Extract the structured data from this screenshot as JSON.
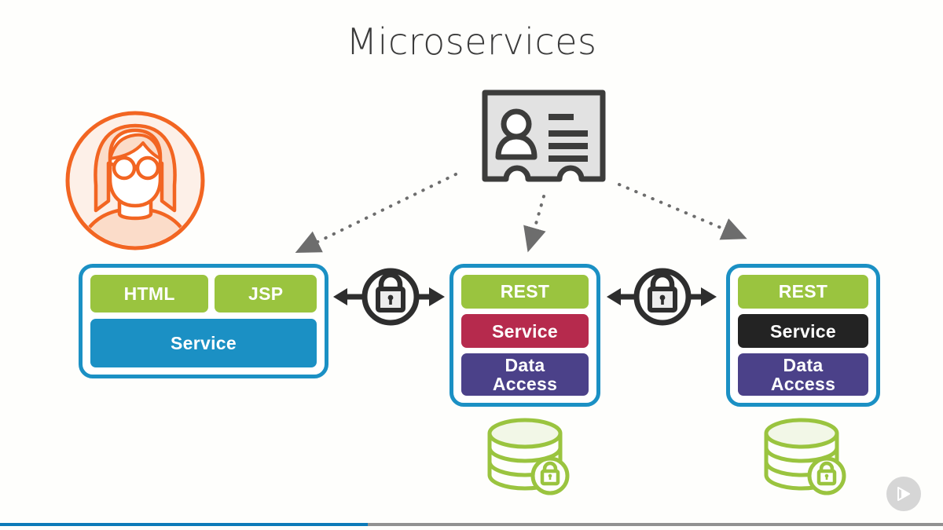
{
  "slide": {
    "title": "Microservices",
    "background_color": "#fefefc"
  },
  "palette": {
    "green": "#9ac43f",
    "blue": "#1b90c4",
    "crimson": "#b62a4d",
    "purple": "#4b4189",
    "black": "#232323",
    "orange": "#f26522",
    "gray_dark": "#3c3c3b",
    "gray_light": "#e2e2e2",
    "progress_blue": "#0c7ab8",
    "progress_track": "#919191"
  },
  "actors": {
    "user": {
      "icon": "user-avatar-icon",
      "label": "",
      "color": "#f26522"
    },
    "identity_card": {
      "icon": "id-badge-icon",
      "label": "",
      "color": "#3c3c3b"
    }
  },
  "connectors": {
    "dotted_arrows": [
      {
        "name": "badge-to-web-tier",
        "style": "dotted",
        "color": "#6d6d6d"
      },
      {
        "name": "badge-to-middle-service",
        "style": "dotted",
        "color": "#6d6d6d"
      },
      {
        "name": "badge-to-right-service",
        "style": "dotted",
        "color": "#6d6d6d"
      }
    ],
    "secure_links": [
      {
        "name": "secure-link-web-to-middle",
        "icon": "lock-circle-icon",
        "direction": "bidirectional"
      },
      {
        "name": "secure-link-middle-to-right",
        "icon": "lock-circle-icon",
        "direction": "bidirectional"
      }
    ]
  },
  "boxes": [
    {
      "name": "web-application-box",
      "layers_top": [
        {
          "label": "HTML",
          "color": "green"
        },
        {
          "label": "JSP",
          "color": "green"
        }
      ],
      "layers_bottom": [
        {
          "label": "Service",
          "color": "blue"
        }
      ],
      "database": null
    },
    {
      "name": "microservice-box-1",
      "layers_top": [
        {
          "label": "REST",
          "color": "green"
        }
      ],
      "layers_bottom": [
        {
          "label": "Service",
          "color": "crimson"
        },
        {
          "label": "Data Access",
          "color": "purple"
        }
      ],
      "database": {
        "icon": "secure-database-icon",
        "color": "#9ac43f"
      }
    },
    {
      "name": "microservice-box-2",
      "layers_top": [
        {
          "label": "REST",
          "color": "green"
        }
      ],
      "layers_bottom": [
        {
          "label": "Service",
          "color": "black"
        },
        {
          "label": "Data Access",
          "color": "purple"
        }
      ],
      "database": {
        "icon": "secure-database-icon",
        "color": "#9ac43f"
      }
    }
  ],
  "labels": {
    "html": "HTML",
    "jsp": "JSP",
    "service_web": "Service",
    "rest_mid": "REST",
    "service_mid": "Service",
    "data_access_mid_line1": "Data",
    "data_access_mid_line2": "Access",
    "rest_right": "REST",
    "service_right": "Service",
    "data_access_right_line1": "Data",
    "data_access_right_line2": "Access"
  },
  "footer": {
    "progress_percent": 39,
    "watermark_icon": "play-logo-icon"
  }
}
